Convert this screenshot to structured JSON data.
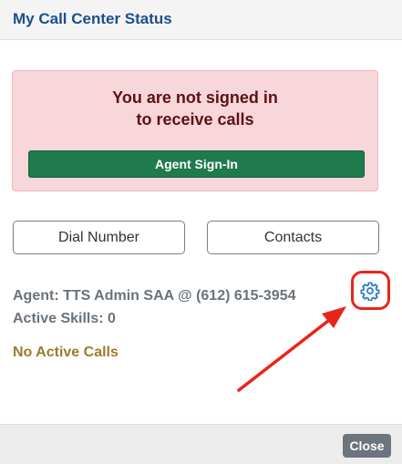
{
  "header": {
    "title": "My Call Center Status"
  },
  "alert": {
    "line1": "You are not signed in",
    "line2": "to receive calls",
    "signin_label": "Agent Sign-In"
  },
  "actions": {
    "dial_label": "Dial Number",
    "contacts_label": "Contacts"
  },
  "agent": {
    "agent_line": "Agent: TTS Admin SAA @ (612) 615-3954",
    "skills_line": "Active Skills: 0",
    "settings_icon": "gear-icon"
  },
  "calls": {
    "status": "No Active Calls"
  },
  "footer": {
    "close_label": "Close"
  },
  "colors": {
    "title": "#1d4f8c",
    "alert_bg": "#f7d7da",
    "signin_bg": "#1f7a4c",
    "gear": "#2f7fd1",
    "highlight": "#e8251c",
    "no_calls": "#9a7d2c",
    "close_bg": "#6c757d"
  }
}
